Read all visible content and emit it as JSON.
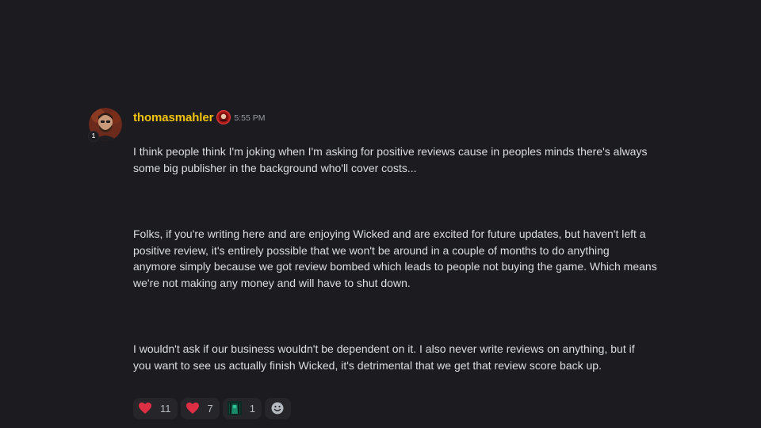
{
  "message": {
    "username": "thomasmahler",
    "timestamp": "5:55 PM",
    "avatar_badge": "1",
    "role_icon": "red-role-badge-icon",
    "paragraphs": [
      "I think people think I'm joking when I'm asking for positive reviews cause in peoples minds there's always\nsome big publisher in the background who'll cover costs...",
      "Folks, if you're writing here and are enjoying Wicked and are excited for future updates, but haven't left a\npositive review, it's entirely possible that we won't be around in a couple of months to do anything\nanymore simply because we got review bombed which leads to people not buying the game. Which means\nwe're not making any money and will have to shut down.",
      "I wouldn't ask if our business wouldn't be dependent on it. I also never write reviews on anything, but if\nyou want to see us actually finish Wicked, it's detrimental that we get that review score back up."
    ],
    "reactions": [
      {
        "emoji": "red-heart-icon",
        "count": "11"
      },
      {
        "emoji": "red-heart-icon",
        "count": "7"
      },
      {
        "emoji": "custom-emoji-icon",
        "count": "1"
      }
    ],
    "add_reaction_icon": "smiley-icon"
  },
  "colors": {
    "background": "#1c1b1f",
    "username": "#f1c40f",
    "text": "#dbdee1",
    "timestamp": "#949ba4",
    "reaction_bg": "#26252a"
  }
}
